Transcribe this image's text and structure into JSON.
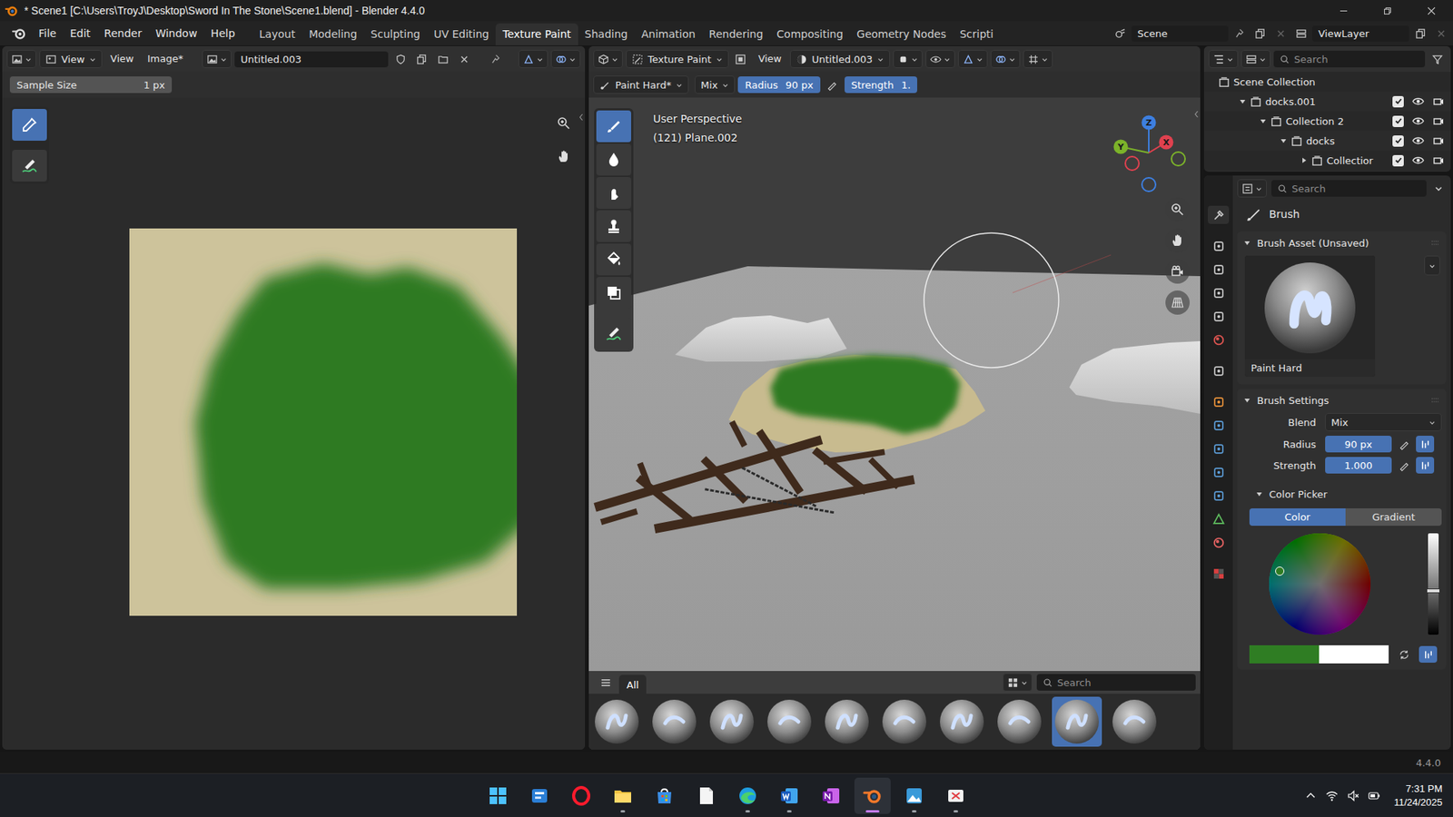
{
  "window": {
    "title": "* Scene1 [C:\\Users\\TroyJ\\Desktop\\Sword In The Stone\\Scene1.blend] - Blender 4.4.0"
  },
  "menu": [
    "File",
    "Edit",
    "Render",
    "Window",
    "Help"
  ],
  "workspaces": [
    {
      "label": "Layout",
      "selected": false
    },
    {
      "label": "Modeling",
      "selected": false
    },
    {
      "label": "Sculpting",
      "selected": false
    },
    {
      "label": "UV Editing",
      "selected": false
    },
    {
      "label": "Texture Paint",
      "selected": true
    },
    {
      "label": "Shading",
      "selected": false
    },
    {
      "label": "Animation",
      "selected": false
    },
    {
      "label": "Rendering",
      "selected": false
    },
    {
      "label": "Compositing",
      "selected": false
    },
    {
      "label": "Geometry Nodes",
      "selected": false
    },
    {
      "label": "Scripti",
      "selected": false
    }
  ],
  "scene": "Scene",
  "view_layer": "ViewLayer",
  "image_editor": {
    "mode": "View",
    "menus": [
      "View",
      "Image*"
    ],
    "image": "Untitled.003",
    "tool_setting": {
      "label": "Sample Size",
      "value": "1 px"
    },
    "tools": [
      {
        "kind": "sample",
        "selected": true
      },
      {
        "kind": "annotate",
        "selected": false
      }
    ]
  },
  "viewport": {
    "mode": "Texture Paint",
    "menus": [
      "View"
    ],
    "image": "Untitled.003",
    "brush": "Paint Hard*",
    "primary_color": "#2f7d23",
    "secondary_color": "#ffffff",
    "blend": "Mix",
    "radius_label": "Radius",
    "radius": "90 px",
    "strength_label": "Strength",
    "strength": "1.",
    "overlay_lines": [
      "User Perspective",
      "(121) Plane.002"
    ],
    "axes": [
      {
        "label": "Z",
        "color": "#3d7fe0"
      },
      {
        "label": "X",
        "color": "#e0414f"
      },
      {
        "label": "Y",
        "color": "#7cb32a"
      }
    ],
    "tools": [
      {
        "kind": "draw",
        "selected": true
      },
      {
        "kind": "soften",
        "selected": false
      },
      {
        "kind": "smear",
        "selected": false
      },
      {
        "kind": "clone",
        "selected": false
      },
      {
        "kind": "fill",
        "selected": false
      },
      {
        "kind": "mask",
        "selected": false
      },
      {
        "kind": "annotate",
        "selected": false
      }
    ],
    "shelf": {
      "tab": "All",
      "search_placeholder": "Search",
      "brushes": [
        {
          "selected": false
        },
        {
          "selected": false
        },
        {
          "selected": false
        },
        {
          "selected": false
        },
        {
          "selected": false
        },
        {
          "selected": false
        },
        {
          "selected": false
        },
        {
          "selected": false
        },
        {
          "selected": true
        },
        {
          "selected": false
        }
      ]
    }
  },
  "outliner": {
    "search_placeholder": "Search",
    "rows": [
      {
        "label": "Scene Collection",
        "kind": "scene",
        "depth": 0,
        "expanded": true
      },
      {
        "label": "docks.001",
        "kind": "collection",
        "depth": 1,
        "expanded": true,
        "checked": true,
        "visible": true
      },
      {
        "label": "Collection 2",
        "kind": "collection",
        "depth": 2,
        "expanded": true,
        "checked": true,
        "visible": true
      },
      {
        "label": "docks",
        "kind": "collection",
        "depth": 3,
        "expanded": true,
        "checked": true,
        "visible": true
      },
      {
        "label": "Collectior",
        "kind": "collection",
        "depth": 4,
        "expanded": false,
        "checked": true,
        "visible": true
      }
    ]
  },
  "properties": {
    "search_placeholder": "Search",
    "context": "Brush",
    "asset_panel": {
      "title": "Brush Asset (Unsaved)",
      "expanded": true,
      "preview_label": "Paint Hard"
    },
    "settings_panel": {
      "title": "Brush Settings",
      "expanded": true,
      "fields": [
        {
          "label": "Blend",
          "value": "Mix",
          "kind": "dropdown"
        },
        {
          "label": "Radius",
          "value": "90 px",
          "kind": "number"
        },
        {
          "label": "Strength",
          "value": "1.000",
          "kind": "number"
        }
      ]
    },
    "color_panel": {
      "title": "Color Picker",
      "expanded": true,
      "modes": [
        {
          "label": "Color",
          "selected": true
        },
        {
          "label": "Gradient",
          "selected": false
        }
      ],
      "value_level": 0.43,
      "primary_color": "#2f7d23",
      "secondary_color": "#ffffff"
    }
  },
  "status_bar": {
    "version": "4.4.0"
  },
  "taskbar": {
    "apps": [
      {
        "kind": "start",
        "running": false,
        "active": false
      },
      {
        "kind": "widgets",
        "running": false,
        "active": false
      },
      {
        "kind": "opera",
        "running": false,
        "active": false
      },
      {
        "kind": "explorer",
        "running": true,
        "active": false
      },
      {
        "kind": "store",
        "running": false,
        "active": false
      },
      {
        "kind": "notepad",
        "running": false,
        "active": false
      },
      {
        "kind": "edge",
        "running": true,
        "active": false
      },
      {
        "kind": "word",
        "running": true,
        "active": false
      },
      {
        "kind": "onenote",
        "running": false,
        "active": false
      },
      {
        "kind": "blender",
        "running": true,
        "active": true
      },
      {
        "kind": "photos",
        "running": true,
        "active": false
      },
      {
        "kind": "snipping",
        "running": true,
        "active": false
      }
    ],
    "time": "7:31 PM",
    "date": "11/24/2025"
  }
}
